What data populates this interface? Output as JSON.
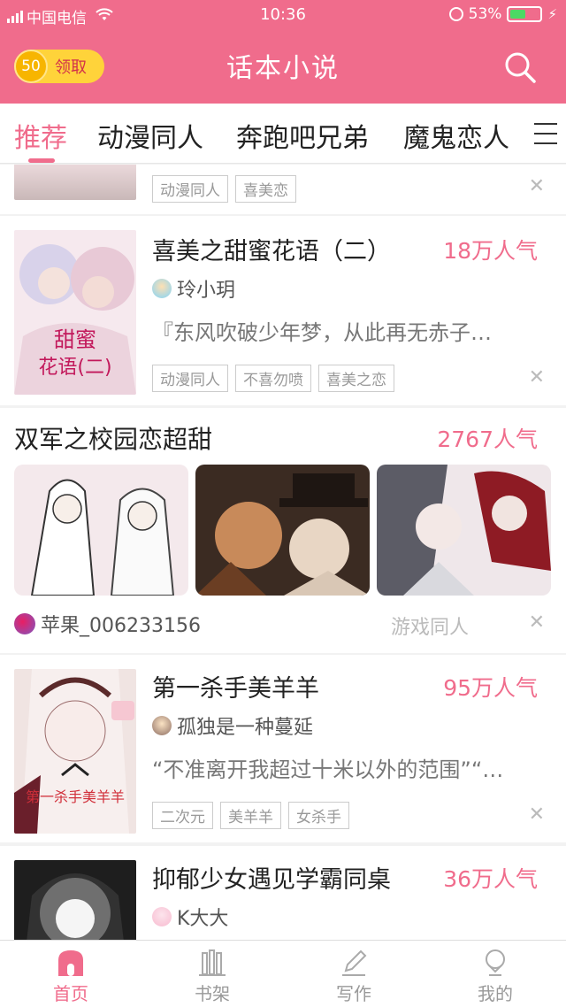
{
  "status_bar": {
    "carrier": "中国电信",
    "time": "10:36",
    "battery": "53%",
    "battery_level": 0.53
  },
  "header": {
    "coin_count": "50",
    "claim_label": "领取",
    "title": "话本小说",
    "search_icon": "search-icon"
  },
  "tabs": [
    {
      "label": "推荐",
      "active": true
    },
    {
      "label": "动漫同人",
      "active": false
    },
    {
      "label": "奔跑吧兄弟",
      "active": false
    },
    {
      "label": "魔鬼恋人",
      "active": false
    }
  ],
  "feed": {
    "partial": {
      "tags": [
        "动漫同人",
        "喜美恋"
      ]
    },
    "book1": {
      "title": "喜美之甜蜜花语（二）",
      "popularity": "18万人气",
      "author": "玲小玥",
      "description": "『东风吹破少年梦，从此再无赤子…",
      "tags": [
        "动漫同人",
        "不喜勿喷",
        "喜美之恋"
      ],
      "cover_text": [
        "甜蜜",
        "花语(二)"
      ]
    },
    "post": {
      "title": "双军之校园恋超甜",
      "popularity": "2767人气",
      "user": "苹果_006233156",
      "category": "游戏同人"
    },
    "book2": {
      "title": "第一杀手美羊羊",
      "popularity": "95万人气",
      "author": "孤独是一种蔓延",
      "description": "“不准离开我超过十米以外的范围”“…",
      "tags": [
        "二次元",
        "美羊羊",
        "女杀手"
      ],
      "cover_text": "第一杀手美羊羊"
    },
    "book3": {
      "title": "抑郁少女遇见学霸同桌",
      "popularity": "36万人气",
      "author": "K大大"
    }
  },
  "bottom_nav": [
    {
      "label": "首页",
      "icon": "home-icon",
      "active": true
    },
    {
      "label": "书架",
      "icon": "bookshelf-icon",
      "active": false
    },
    {
      "label": "写作",
      "icon": "pen-icon",
      "active": false
    },
    {
      "label": "我的",
      "icon": "profile-icon",
      "active": false
    }
  ],
  "colors": {
    "accent": "#f06c8c",
    "coin": "#ffd33a"
  }
}
